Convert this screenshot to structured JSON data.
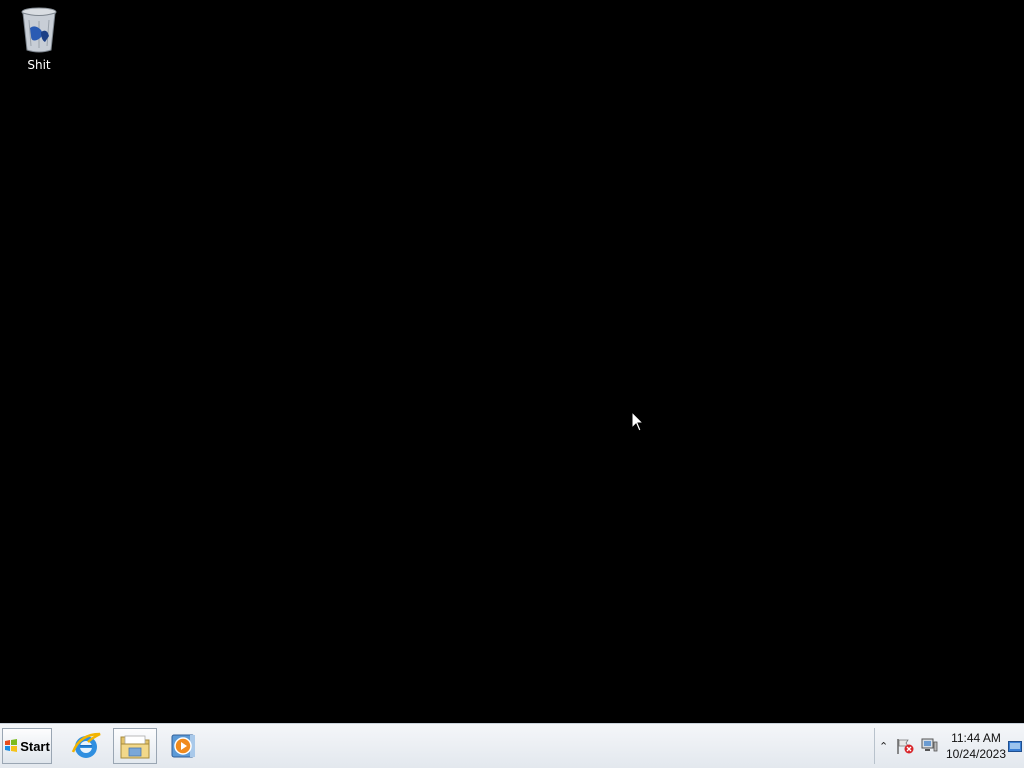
{
  "desktop": {
    "icons": [
      {
        "label": "Shit",
        "icon": "recycle-bin-icon"
      }
    ]
  },
  "taskbar": {
    "start_label": "Start",
    "apps": [
      {
        "icon": "internet-explorer-icon"
      },
      {
        "icon": "file-explorer-icon"
      },
      {
        "icon": "windows-media-player-icon"
      }
    ],
    "tray": {
      "time": "11:44 AM",
      "date": "10/24/2023"
    }
  },
  "colors": {
    "desktop_background": "#000000",
    "taskbar_background": "#eef1f5"
  }
}
